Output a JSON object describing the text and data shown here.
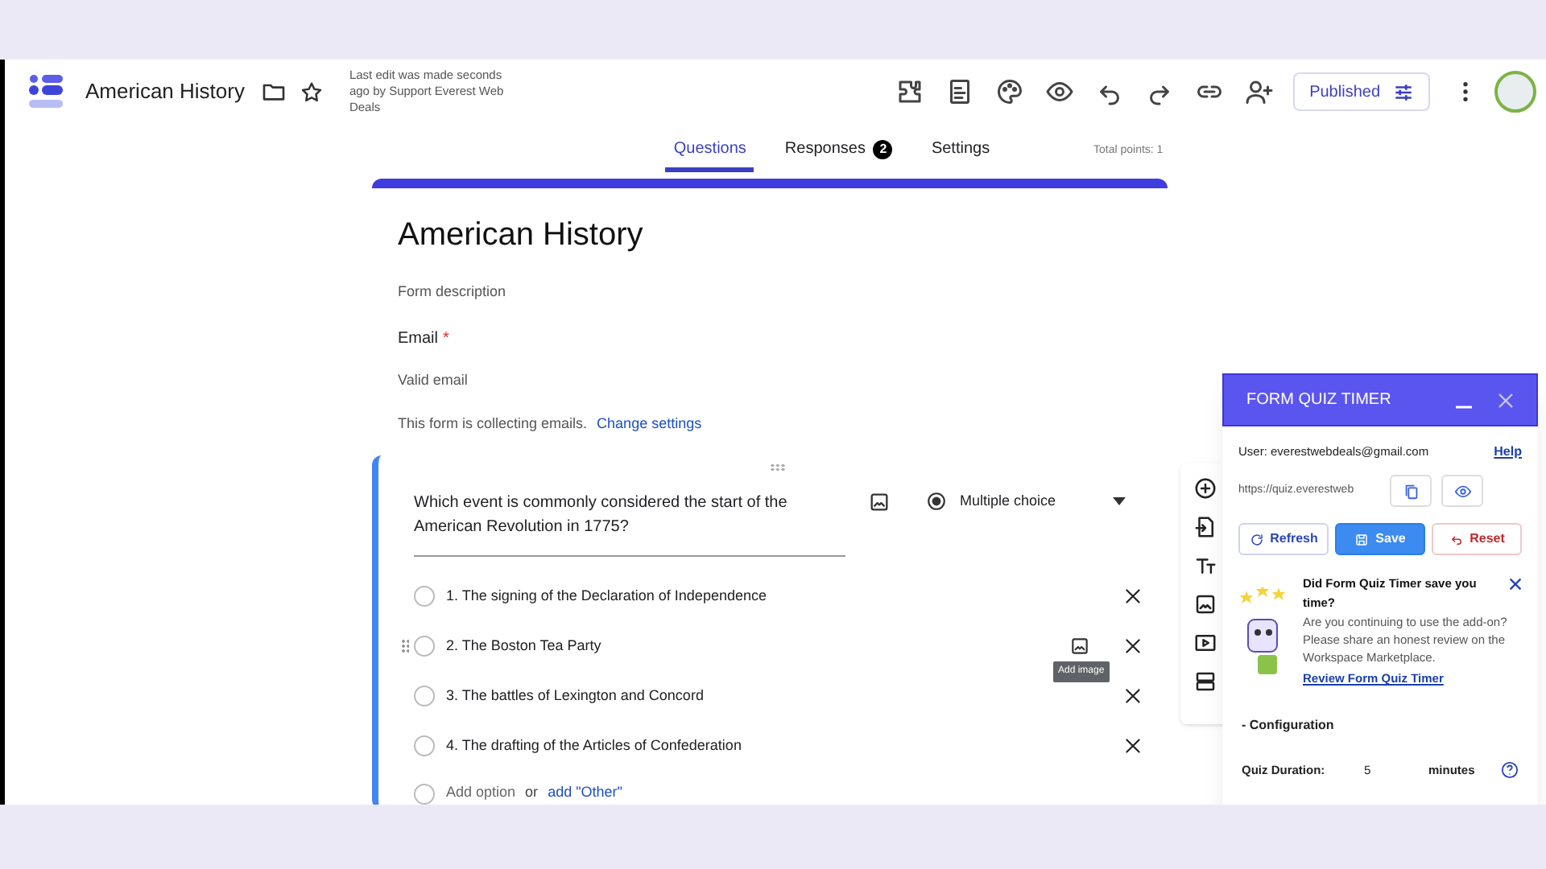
{
  "header": {
    "title": "American History",
    "last_edit": "Last edit was made seconds ago by Support Everest Web Deals",
    "publish_button": "Published"
  },
  "tabs": [
    {
      "label": "Questions",
      "selected": true
    },
    {
      "label": "Responses",
      "badge": "2",
      "selected": false
    },
    {
      "label": "Settings",
      "selected": false
    }
  ],
  "total_points": "Total points: 1",
  "form_header": {
    "title": "American History",
    "description_placeholder": "Form description",
    "email_label": "Email",
    "required_mark": "*",
    "email_placeholder": "Valid email",
    "collecting_note": "This form is collecting emails.",
    "change_link": "Change settings"
  },
  "question": {
    "text": "Which event is commonly considered the start of the American Revolution in 1775?",
    "type": "Multiple choice",
    "options": [
      {
        "label": "1. The signing of the Declaration of Independence",
        "hovered": false
      },
      {
        "label": "2. The Boston Tea Party",
        "hovered": true
      },
      {
        "label": "3. The battles of Lexington and Concord",
        "hovered": false
      },
      {
        "label": "4. The drafting of the Articles of Confederation",
        "hovered": false
      }
    ],
    "tooltip": "Add image",
    "add_option": "Add option",
    "or": "or",
    "add_other": "add \"Other\""
  },
  "panel": {
    "title": "FORM QUIZ TIMER",
    "user": "User: everestwebdeals@gmail.com",
    "help": "Help",
    "url": "https://quiz.everestweb",
    "buttons": [
      {
        "label": "Refresh",
        "kind": "refresh"
      },
      {
        "label": "Save",
        "kind": "save"
      },
      {
        "label": "Reset",
        "kind": "reset"
      }
    ],
    "review_title": "Did Form Quiz Timer save you time?",
    "review_text": "Are you continuing to use the add-on? Please share an honest review on the Workspace Marketplace.",
    "review_link": "Review Form Quiz Timer",
    "section": "- Configuration",
    "duration_label": "Quiz Duration:",
    "duration_value": "5",
    "duration_unit": "minutes"
  }
}
